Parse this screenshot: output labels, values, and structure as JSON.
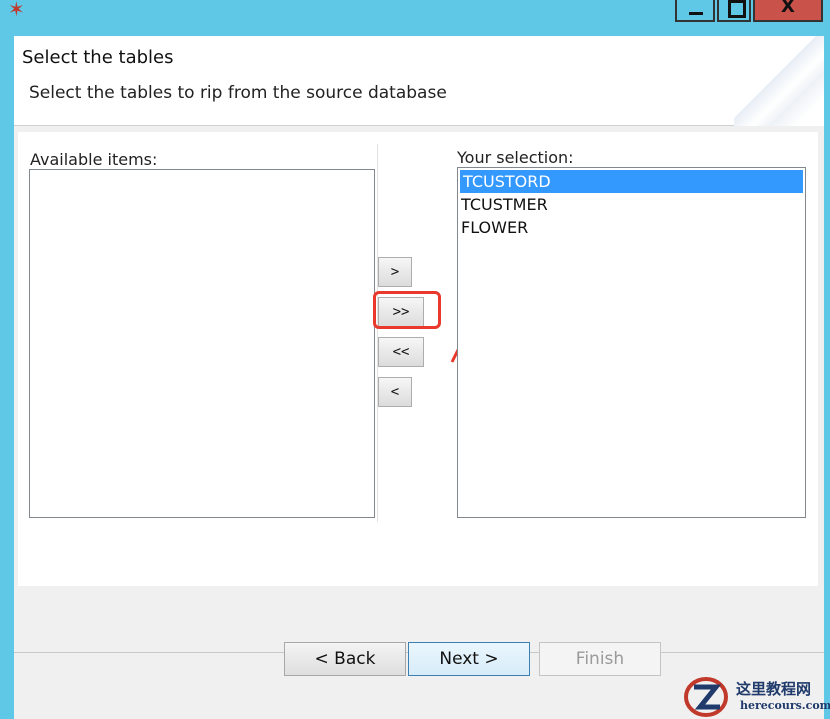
{
  "window": {
    "app_icon": "wizard-wand-icon",
    "close_label": "X"
  },
  "header": {
    "title": "Select the tables",
    "subtitle": "Select the tables to rip from the source database"
  },
  "available": {
    "label": "Available items:",
    "items": []
  },
  "selection": {
    "label": "Your selection:",
    "items": [
      "TCUSTORD",
      "TCUSTMER",
      "FLOWER"
    ],
    "selected_index": 0
  },
  "move_buttons": {
    "add": ">",
    "add_all": ">>",
    "remove_all": "<<",
    "remove": "<"
  },
  "nav": {
    "back": "< Back",
    "next": "Next >",
    "finish": "Finish"
  },
  "watermark": {
    "title": "这里教程网",
    "url": "herecours.com"
  },
  "colors": {
    "titlebar": "#5ec8e6",
    "selection_highlight": "#3399ff",
    "annotation_red": "#e8392c"
  }
}
